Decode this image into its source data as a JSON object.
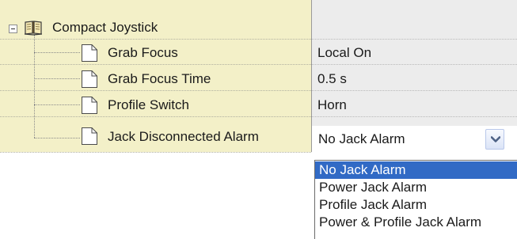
{
  "tree": {
    "root": {
      "label": "Compact Joystick",
      "expander_icon": "collapse-minus-icon",
      "icon": "book-icon"
    },
    "rows": [
      {
        "label": "Grab Focus",
        "value": "Local On",
        "icon": "page-icon"
      },
      {
        "label": "Grab Focus Time",
        "value": "0.5 s",
        "icon": "page-icon"
      },
      {
        "label": "Profile Switch",
        "value": "Horn",
        "icon": "page-icon"
      },
      {
        "label": "Jack Disconnected Alarm",
        "value": "No Jack Alarm",
        "icon": "page-icon"
      }
    ]
  },
  "combo": {
    "value": "No Jack Alarm",
    "arrow_icon": "chevron-down-icon"
  },
  "dropdown": {
    "options": [
      "No Jack Alarm",
      "Power Jack Alarm",
      "Profile Jack Alarm",
      "Power & Profile Jack Alarm"
    ],
    "selected": "No Jack Alarm"
  },
  "colors": {
    "label_column_bg": "#f3f0c8",
    "value_column_bg": "#ececec",
    "selection": "#316ac5"
  }
}
